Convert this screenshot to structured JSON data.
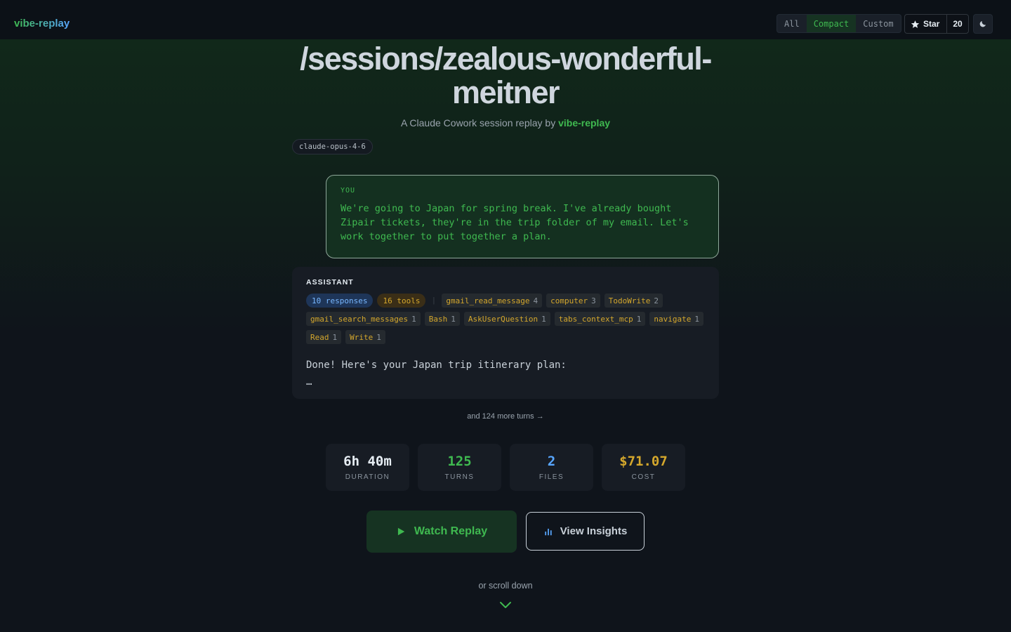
{
  "header": {
    "brand": "vibe-replay",
    "view_modes": [
      "All",
      "Compact",
      "Custom"
    ],
    "active_view_mode": "Compact",
    "star_label": "Star",
    "star_count": "20",
    "theme_icon": "moon-icon"
  },
  "hero": {
    "title": "/sessions/zealous-wonderful-meitner",
    "subtitle_prefix": "A Claude Cowork session replay by",
    "subtitle_link": "vibe-replay",
    "model_tag": "claude-opus-4-6"
  },
  "you_message": {
    "label": "YOU",
    "text": "We're going to Japan for spring break. I've already bought Zipair tickets, they're in the trip folder of my email. Let's work together to put together a plan."
  },
  "assistant_message": {
    "label": "ASSISTANT",
    "responses_chip": "10 responses",
    "tools_chip": "16 tools",
    "separator": "|",
    "tools": [
      {
        "name": "gmail_read_message",
        "count": "4"
      },
      {
        "name": "computer",
        "count": "3"
      },
      {
        "name": "TodoWrite",
        "count": "2"
      },
      {
        "name": "gmail_search_messages",
        "count": "1"
      },
      {
        "name": "Bash",
        "count": "1"
      },
      {
        "name": "AskUserQuestion",
        "count": "1"
      },
      {
        "name": "tabs_context_mcp",
        "count": "1"
      },
      {
        "name": "navigate",
        "count": "1"
      },
      {
        "name": "Read",
        "count": "1"
      },
      {
        "name": "Write",
        "count": "1"
      }
    ],
    "text": "Done! Here's your Japan trip itinerary plan:",
    "ellipsis": "…"
  },
  "more_turns": "and 124 more turns →",
  "stats": [
    {
      "value": "6h 40m",
      "label": "DURATION",
      "color": "#e6edf3"
    },
    {
      "value": "125",
      "label": "TURNS",
      "color": "#3fb950"
    },
    {
      "value": "2",
      "label": "FILES",
      "color": "#58a6ff"
    },
    {
      "value": "$71.07",
      "label": "COST",
      "color": "#d4a72c"
    }
  ],
  "actions": {
    "watch_label": "Watch Replay",
    "insights_label": "View Insights"
  },
  "scroll_hint": "or scroll down",
  "colors": {
    "accent_green": "#3fb950",
    "accent_blue": "#58a6ff",
    "accent_amber": "#d4a72c",
    "background": "#0f141b"
  }
}
